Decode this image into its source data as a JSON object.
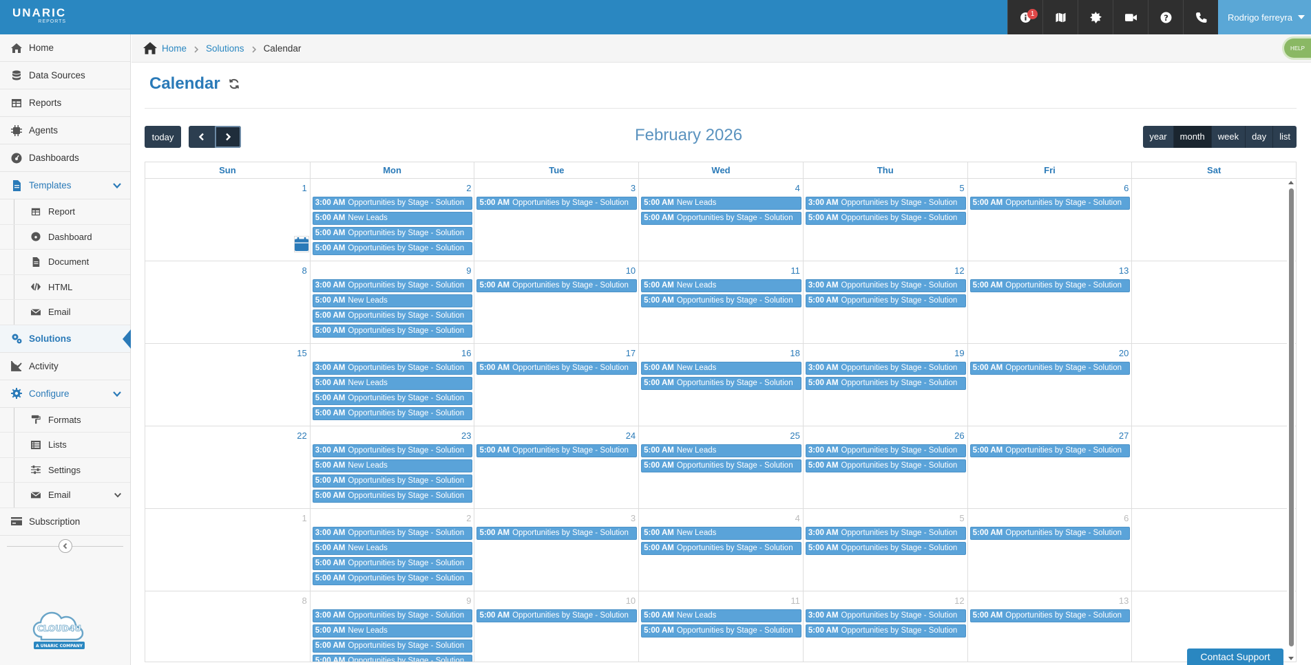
{
  "app": {
    "brand": "UNARIC",
    "brand_sub": "REPORTS"
  },
  "topbar": {
    "notification_count": "1",
    "user_name": "Rodrigo ferreyra",
    "icons": [
      "info-icon",
      "map-icon",
      "settings-burst-icon",
      "video-icon",
      "help-icon",
      "phone-icon"
    ]
  },
  "sidebar": {
    "home": "Home",
    "data_sources": "Data Sources",
    "reports": "Reports",
    "agents": "Agents",
    "dashboards": "Dashboards",
    "templates": "Templates",
    "templates_items": [
      "Report",
      "Dashboard",
      "Document",
      "HTML",
      "Email"
    ],
    "solutions": "Solutions",
    "activity": "Activity",
    "configure": "Configure",
    "configure_items": [
      "Formats",
      "Lists",
      "Settings",
      "Email"
    ],
    "subscription": "Subscription",
    "cloud_logo_text": "CLOUD4U",
    "cloud_logo_sub": "A UNARIC COMPANY"
  },
  "breadcrumb": {
    "home": "Home",
    "solutions": "Solutions",
    "current": "Calendar"
  },
  "help_tab": "HELP",
  "page": {
    "title": "Calendar"
  },
  "toolbar": {
    "today": "today",
    "month_title": "February 2026",
    "views": [
      "year",
      "month",
      "week",
      "day",
      "list"
    ],
    "active_view": "month"
  },
  "calendar": {
    "weekdays": [
      "Sun",
      "Mon",
      "Tue",
      "Wed",
      "Thu",
      "Fri",
      "Sat"
    ],
    "weeks": [
      [
        "1",
        "2",
        "3",
        "4",
        "5",
        "6",
        ""
      ],
      [
        "8",
        "9",
        "10",
        "11",
        "12",
        "13",
        ""
      ],
      [
        "15",
        "16",
        "17",
        "18",
        "19",
        "20",
        ""
      ],
      [
        "22",
        "23",
        "24",
        "25",
        "26",
        "27",
        ""
      ],
      [
        "1",
        "2",
        "3",
        "4",
        "5",
        "6",
        ""
      ],
      [
        "8",
        "9",
        "10",
        "11",
        "12",
        "13",
        ""
      ]
    ],
    "other_month_weeks": [
      4,
      5
    ],
    "events": {
      "mon": [
        {
          "time": "3:00 AM",
          "title": "Opportunities by Stage - Solution"
        },
        {
          "time": "5:00 AM",
          "title": "New Leads"
        },
        {
          "time": "5:00 AM",
          "title": "Opportunities by Stage - Solution"
        },
        {
          "time": "5:00 AM",
          "title": "Opportunities by Stage - Solution"
        }
      ],
      "tue": [
        {
          "time": "5:00 AM",
          "title": "Opportunities by Stage - Solution"
        }
      ],
      "wed": [
        {
          "time": "5:00 AM",
          "title": "New Leads"
        },
        {
          "time": "5:00 AM",
          "title": "Opportunities by Stage - Solution"
        }
      ],
      "thu": [
        {
          "time": "3:00 AM",
          "title": "Opportunities by Stage - Solution"
        },
        {
          "time": "5:00 AM",
          "title": "Opportunities by Stage - Solution"
        }
      ],
      "fri": [
        {
          "time": "5:00 AM",
          "title": "Opportunities by Stage - Solution"
        }
      ]
    }
  },
  "contact_support": "Contact Support",
  "colors": {
    "topbar": "#2a87c1",
    "accent": "#2a7ab8",
    "event": "#5aa3d9",
    "button": "#2c3e50"
  }
}
